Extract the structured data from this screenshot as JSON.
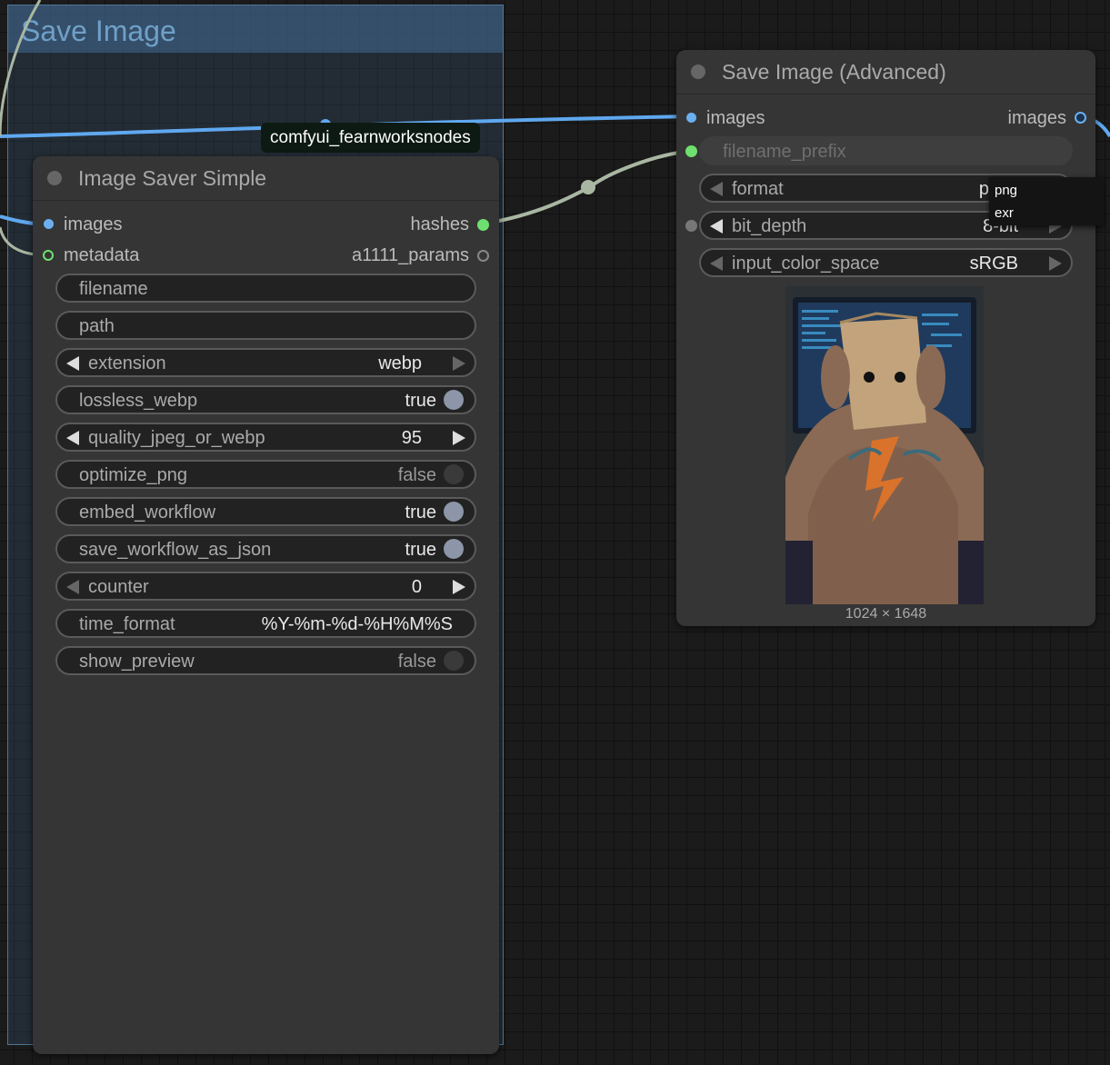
{
  "group": {
    "title": "Save Image"
  },
  "badge": {
    "label": "comfyui_fearnworksnodes"
  },
  "saver": {
    "title": "Image Saver Simple",
    "inputs": [
      "images",
      "metadata"
    ],
    "outputs": [
      "hashes",
      "a1111_params"
    ],
    "widgets": {
      "filename": {
        "label": "filename"
      },
      "path": {
        "label": "path"
      },
      "extension": {
        "label": "extension",
        "value": "webp"
      },
      "lossless_webp": {
        "label": "lossless_webp",
        "value": "true"
      },
      "quality": {
        "label": "quality_jpeg_or_webp",
        "value": "95"
      },
      "optimize_png": {
        "label": "optimize_png",
        "value": "false"
      },
      "embed_workflow": {
        "label": "embed_workflow",
        "value": "true"
      },
      "save_workflow_as_json": {
        "label": "save_workflow_as_json",
        "value": "true"
      },
      "counter": {
        "label": "counter",
        "value": "0"
      },
      "time_format": {
        "label": "time_format",
        "value": "%Y-%m-%d-%H%M%S"
      },
      "show_preview": {
        "label": "show_preview",
        "value": "false"
      }
    }
  },
  "advanced": {
    "title": "Save Image (Advanced)",
    "input": "images",
    "output": "images",
    "widgets": {
      "filename_prefix": {
        "label": "filename_prefix"
      },
      "format": {
        "label": "format",
        "value": "p"
      },
      "bit_depth": {
        "label": "bit_depth",
        "value": "8-bit"
      },
      "input_color_space": {
        "label": "input_color_space",
        "value": "sRGB"
      }
    },
    "preview_caption": "1024 × 1648"
  },
  "dropdown": {
    "options": [
      "png",
      "exr"
    ]
  },
  "colors": {
    "image_slot": "#6ab0f0",
    "metadata_slot": "#6fe06f",
    "wire_blue": "#5fa8ef",
    "wire_gray": "#a9b7a2"
  }
}
